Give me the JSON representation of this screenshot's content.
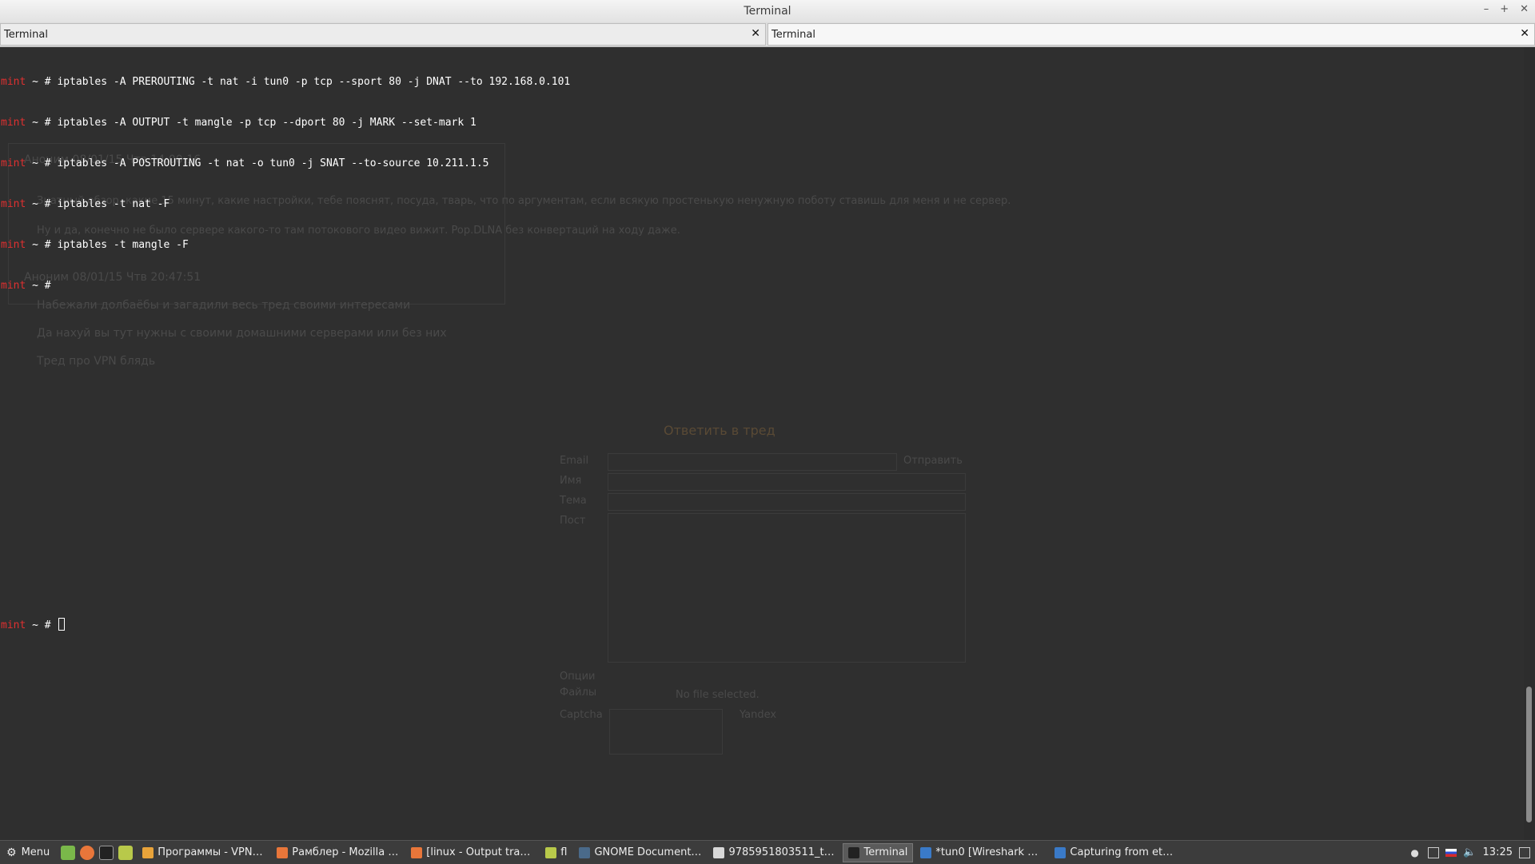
{
  "window": {
    "title": "Terminal"
  },
  "tabs": [
    {
      "label": "Terminal",
      "close": "✕"
    },
    {
      "label": "Terminal",
      "close": "✕"
    }
  ],
  "terminal": {
    "user": "mint",
    "prompt_suffix": " ~ # ",
    "lines": [
      {
        "command": "iptables -A PREROUTING -t nat -i tun0 -p tcp --sport 80 -j DNAT --to 192.168.0.101"
      },
      {
        "command": "iptables -A OUTPUT -t mangle -p tcp --dport 80 -j MARK --set-mark 1"
      },
      {
        "command": "iptables -A POSTROUTING -t nat -o tun0 -j SNAT --to-source 10.211.1.5"
      },
      {
        "command": "iptables -t nat -F"
      },
      {
        "command": "iptables -t mangle -F"
      },
      {
        "command": ""
      }
    ],
    "final_prompt_command": ""
  },
  "ghost_background": {
    "post_header": "Аноним 08/01/15 Чтв 14:00:16",
    "post_body_1": "Знатный обзор, какие 15 минут, какие настройки, тебе пояснят, посуда, тварь, что по аргументам, если всякую простенькую ненужную поботу ставишь для меня и не сервер.",
    "post_body_2": "Ну и да, конечно не было сервере какого-то там потокового видео вижит. Pop.DLNA без конвертаций на ходу даже.",
    "post_header_2": "Аноним 08/01/15 Чтв 20:47:51",
    "post_body_3": "Набежали долбаёбы и загадили весь тред своими интересами",
    "post_body_4": "Да нахуй вы тут нужны с своими домашними серверами или без них",
    "post_body_5": "Тред про VPN блядь",
    "reply_button": "Ответить в тред",
    "form_email": "Email",
    "form_name": "Имя",
    "form_subject": "Тема",
    "form_post": "Пост",
    "form_send": "Отправить",
    "form_options": "Опции",
    "form_files": "Файлы",
    "form_captcha": "Captcha",
    "no_file": "No file selected.",
    "captcha_word": "Yandex"
  },
  "taskbar": {
    "menu_label": "Menu",
    "items": [
      {
        "label": "Программы - VPN-тр...",
        "icon_color": "#e8a33a",
        "active": false
      },
      {
        "label": "Рамблер - Mozilla Fir...",
        "icon_color": "#e8763a",
        "active": false
      },
      {
        "label": "[linux - Output traffic ...",
        "icon_color": "#e8763a",
        "active": false
      },
      {
        "label": "fl",
        "icon_color": "#b8c94a",
        "active": false
      },
      {
        "label": "GNOME Document P...",
        "icon_color": "#4a6a8a",
        "active": false
      },
      {
        "label": "9785951803511_the_...",
        "icon_color": "#d8d8d8",
        "active": false
      },
      {
        "label": "Terminal",
        "icon_color": "#222222",
        "active": true
      },
      {
        "label": "*tun0   [Wireshark 1....",
        "icon_color": "#3a7ac8",
        "active": false
      },
      {
        "label": "Capturing from eth0 ...",
        "icon_color": "#3a7ac8",
        "active": false
      }
    ],
    "clock": "13:25"
  },
  "colors": {
    "prompt_user": "#e03030",
    "terminal_bg": "#2f2f2f",
    "taskbar_bg": "#3c3c3c"
  }
}
